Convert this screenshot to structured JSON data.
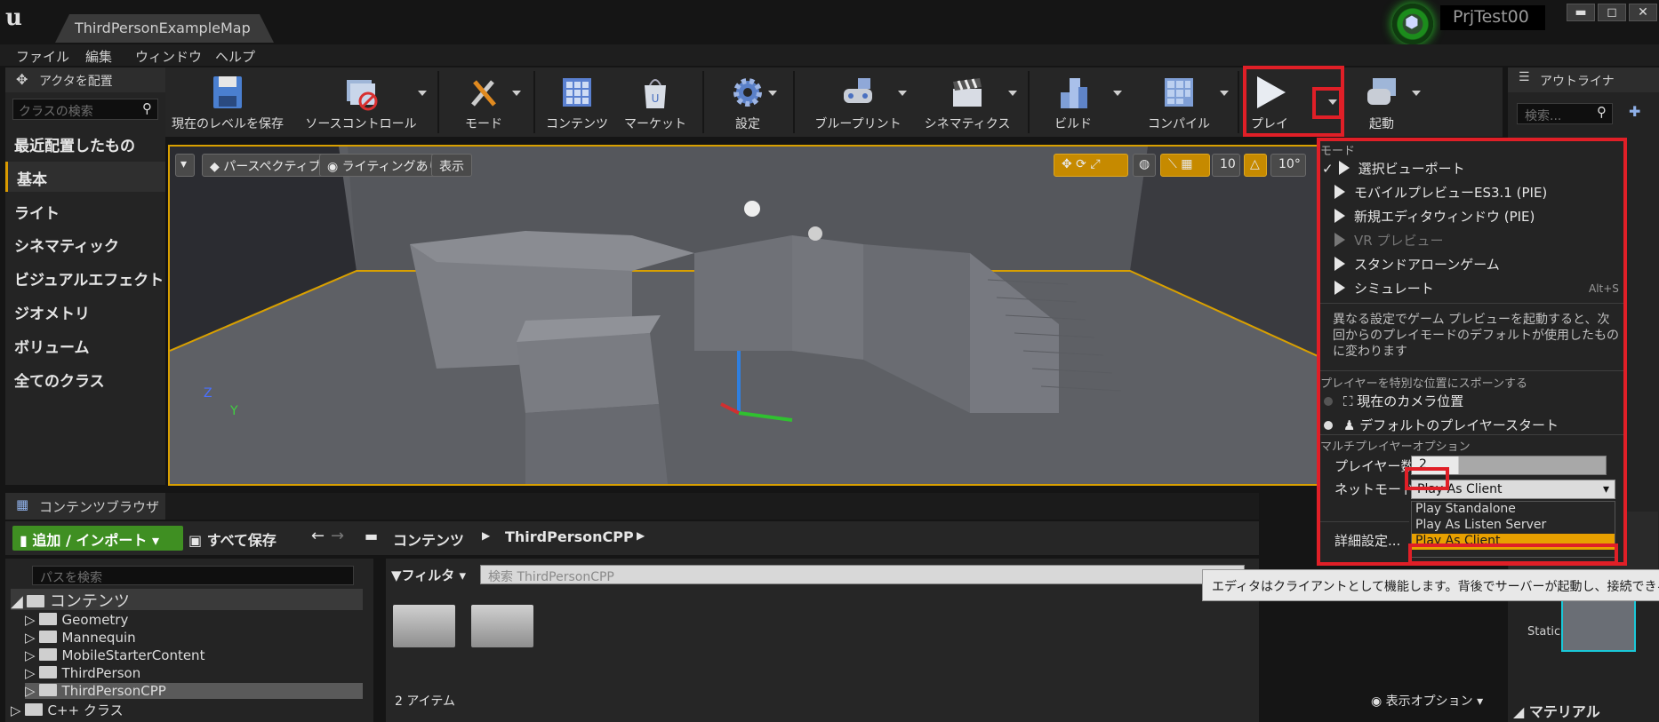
{
  "window": {
    "map_tab": "ThirdPersonExampleMap",
    "project_name": "PrjTest00",
    "minimize": "▬",
    "maximize": "◻",
    "close": "✕"
  },
  "menu": [
    "ファイル",
    "編集",
    "ウィンドウ",
    "ヘルプ"
  ],
  "place_actors": {
    "title": "アクタを配置",
    "search_placeholder": "クラスの検索",
    "categories": [
      "最近配置したもの",
      "基本",
      "ライト",
      "シネマティック",
      "ビジュアルエフェクト",
      "ジオメトリ",
      "ボリューム",
      "全てのクラス"
    ],
    "active_category": "基本"
  },
  "toolbar": {
    "save": "現在のレベルを保存",
    "source_control": "ソースコントロール",
    "modes": "モード",
    "content": "コンテンツ",
    "marketplace": "マーケット",
    "settings": "設定",
    "blueprints": "ブループリント",
    "cinematics": "シネマティクス",
    "build": "ビルド",
    "compile": "コンパイル",
    "play": "プレイ",
    "launch": "起動"
  },
  "outliner": {
    "title": "アウトライナ",
    "search_placeholder": "検索..."
  },
  "viewport": {
    "perspective": "パースペクティブ",
    "lighting": "ライティングあり",
    "show": "表示",
    "grid_size": "10",
    "rotation": "10°",
    "axis_z": "Z",
    "axis_y": "Y"
  },
  "play_menu": {
    "modes_header": "モード",
    "items": [
      "選択ビューポート",
      "モバイルプレビューES3.1 (PIE)",
      "新規エディタウィンドウ (PIE)",
      "VR プレビュー",
      "スタンドアローンゲーム",
      "シミュレート"
    ],
    "simulate_shortcut": "Alt+S",
    "description": "異なる設定でゲーム プレビューを起動すると、次回からのプレイモードのデフォルトが使用したものに変わります",
    "spawn_header": "プレイヤーを特別な位置にスポーンする",
    "spawn_camera": "現在のカメラ位置",
    "spawn_default": "デフォルトのプレイヤースタート",
    "multiplayer_header": "マルチプレイヤーオプション",
    "players_label": "プレイヤー数",
    "players_value": "2",
    "net_mode_label": "ネットモード",
    "net_mode_value": "Play As Client",
    "net_mode_options": [
      "Play Standalone",
      "Play As Listen Server",
      "Play As Client"
    ],
    "advanced": "詳細設定..."
  },
  "tooltip": "エディタはクライアントとして機能します。背後でサーバーが起動し、接続できるようになります",
  "content_browser": {
    "tab": "コンテンツブラウザ",
    "add_import": "追加 / インポート",
    "save_all": "すべて保存",
    "path_root": "コンテンツ",
    "path_current": "ThirdPersonCPP",
    "path_search_placeholder": "パスを検索",
    "filter": "フィルタ",
    "asset_search_placeholder": "検索 ThirdPersonCPP",
    "tree_root": "コンテンツ",
    "tree": [
      "Geometry",
      "Mannequin",
      "MobileStarterContent",
      "ThirdPerson",
      "ThirdPersonCPP",
      "C++ クラス"
    ],
    "item_count": "2 アイテム",
    "view_options": "表示オプション",
    "static_label": "Static",
    "material": "マテリアル"
  },
  "colors": {
    "accent_orange": "#d99a00",
    "highlight_red": "#e01f27",
    "add_button_green": "#3f8f22",
    "selected_option": "#e8a000"
  }
}
